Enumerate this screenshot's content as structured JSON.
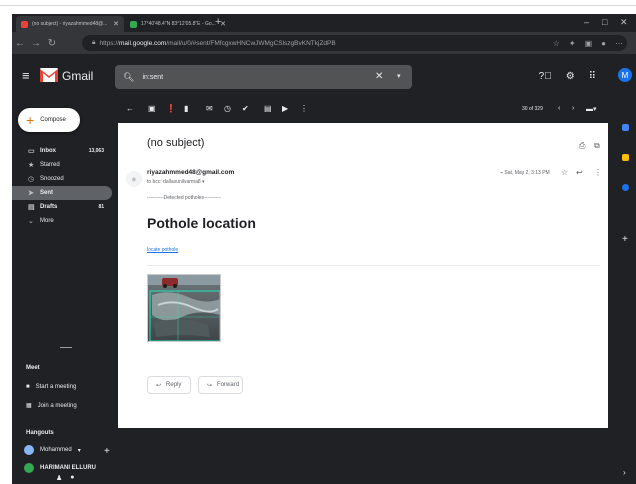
{
  "browser": {
    "tabs": [
      {
        "title": "(no subject) - riyazahmmed48@...",
        "favicon_color": "#ea4335"
      },
      {
        "title": "17°40'48.4\"N 83°12'05.8\"E - Go...",
        "favicon_color": "#34a853"
      }
    ],
    "new_tab": "+",
    "window_controls": [
      "–",
      "□",
      "✕"
    ],
    "url_prefix": "https://",
    "url_host": "mail.google.com",
    "url_path": "/mail/u/0/#sent/FMfcgxwHNCwJWMgCSlszgBvKNTkjZdPB"
  },
  "gmail": {
    "logo_text": "Gmail",
    "search_value": "in:sent",
    "avatar_letter": "M",
    "compose_label": "Compose",
    "nav": [
      {
        "label": "Inbox",
        "count": "13,063",
        "icon": "inbox-icon",
        "glyph": "▭"
      },
      {
        "label": "Starred",
        "count": "",
        "icon": "star-icon",
        "glyph": "★"
      },
      {
        "label": "Snoozed",
        "count": "",
        "icon": "clock-icon",
        "glyph": "◷"
      },
      {
        "label": "Sent",
        "count": "",
        "icon": "send-icon",
        "glyph": "➤"
      },
      {
        "label": "Drafts",
        "count": "81",
        "icon": "draft-icon",
        "glyph": "▤"
      },
      {
        "label": "More",
        "count": "",
        "icon": "chevron-down-icon",
        "glyph": "⌄"
      }
    ],
    "meet_title": "Meet",
    "meet_items": [
      "Start a meeting",
      "Join a meeting"
    ],
    "hangouts_title": "Hangouts",
    "hangouts_user": "Mohammed",
    "hangouts_contact": "HARIMANI ELLURU",
    "pager": "30 of 329"
  },
  "message": {
    "subject": "(no subject)",
    "sender": "riyazahmmed48@gmail.com",
    "to_line": "to bcc: dallasunilvarma8",
    "date": "Sat, May 2, 3:13 PM",
    "detected_line": "----------Detected potholes----------",
    "headline": "Pothole location",
    "link": "locate pothole",
    "reply_label": "Reply",
    "forward_label": "Forward"
  },
  "colors": {
    "dark_bg": "#202124",
    "accent_blue": "#1a73e8",
    "gmail_red": "#ea4335"
  }
}
